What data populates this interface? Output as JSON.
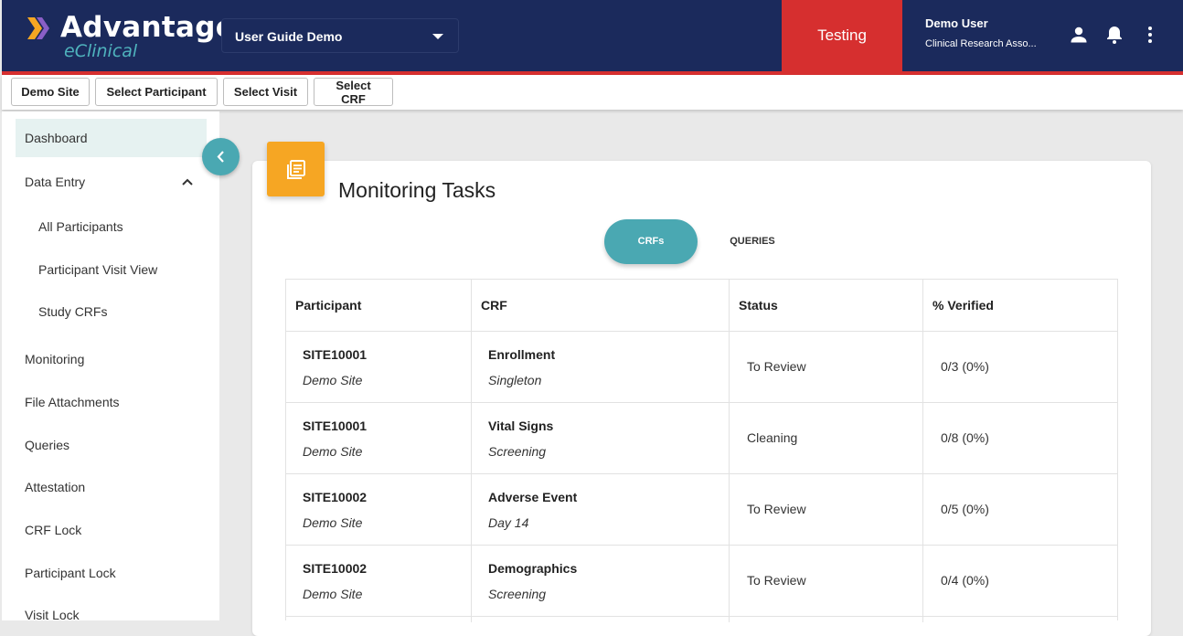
{
  "header": {
    "logo_main": "Advantage",
    "logo_sub": "eClinical",
    "study_select": "User Guide Demo",
    "environment": "Testing",
    "user_name": "Demo User",
    "user_role": "Clinical Research Asso...",
    "icons": [
      "person-icon",
      "bell-icon",
      "more-vert-icon"
    ],
    "colors": {
      "header_bg": "#1b2a5c",
      "accent_red": "#d62f2f",
      "teal": "#4aa8b2",
      "orange": "#f6a623"
    }
  },
  "subbar": {
    "site": "Demo Site",
    "participant": "Select Participant",
    "visit": "Select Visit",
    "crf": "Select CRF"
  },
  "sidebar": {
    "items": [
      {
        "label": "Dashboard"
      },
      {
        "label": "Data Entry"
      },
      {
        "label": "All Participants"
      },
      {
        "label": "Participant Visit View"
      },
      {
        "label": "Study CRFs"
      },
      {
        "label": "Monitoring"
      },
      {
        "label": "File Attachments"
      },
      {
        "label": "Queries"
      },
      {
        "label": "Attestation"
      },
      {
        "label": "CRF Lock"
      },
      {
        "label": "Participant Lock"
      },
      {
        "label": "Visit Lock"
      }
    ]
  },
  "main": {
    "title": "Monitoring Tasks",
    "tabs": [
      {
        "label": "CRFs"
      },
      {
        "label": "QUERIES"
      }
    ],
    "columns": [
      "Participant",
      "CRF",
      "Status",
      "% Verified"
    ],
    "rows": [
      {
        "participant": "SITE10001",
        "site": "Demo Site",
        "crf": "Enrollment",
        "visit": "Singleton",
        "status": "To Review",
        "verified": "0/3 (0%)"
      },
      {
        "participant": "SITE10001",
        "site": "Demo Site",
        "crf": "Vital Signs",
        "visit": "Screening",
        "status": "Cleaning",
        "verified": "0/8 (0%)"
      },
      {
        "participant": "SITE10002",
        "site": "Demo Site",
        "crf": "Adverse Event",
        "visit": "Day 14",
        "status": "To Review",
        "verified": "0/5 (0%)"
      },
      {
        "participant": "SITE10002",
        "site": "Demo Site",
        "crf": "Demographics",
        "visit": "Screening",
        "status": "To Review",
        "verified": "0/4 (0%)"
      }
    ]
  }
}
